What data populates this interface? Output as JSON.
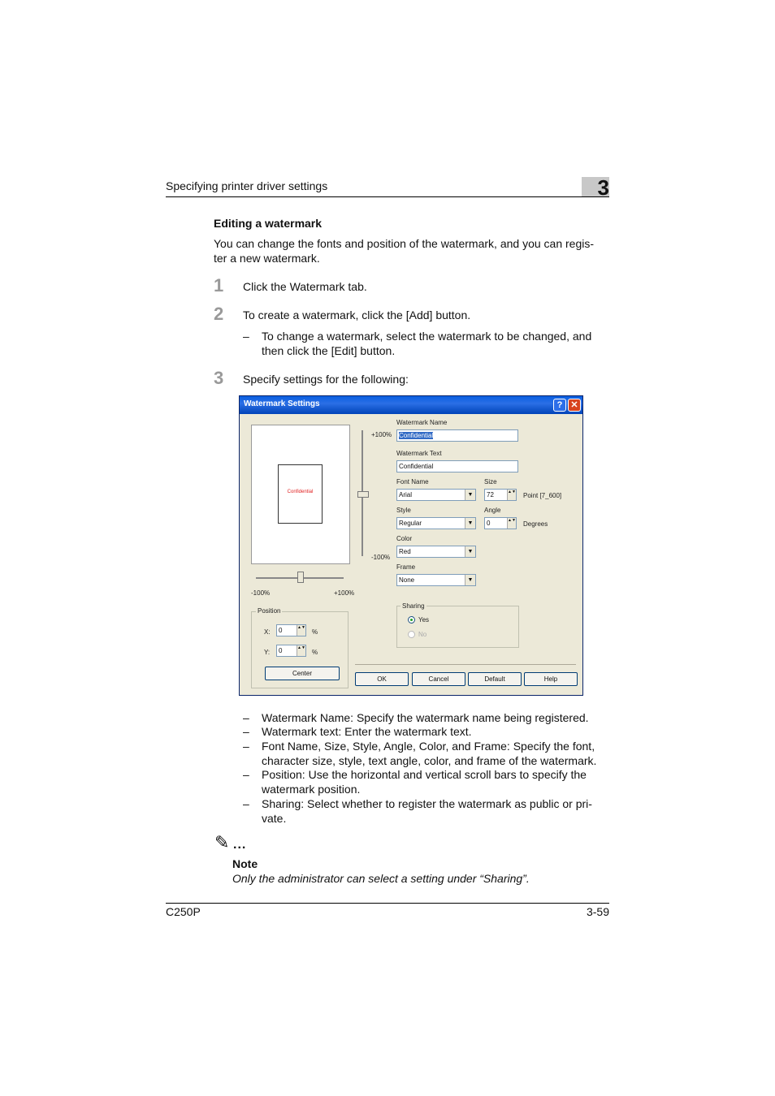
{
  "header": {
    "title": "Specifying printer driver settings",
    "chapter": "3"
  },
  "section": {
    "title": "Editing a watermark",
    "intro_line1": "You can change the fonts and position of the watermark, and you can regis-",
    "intro_line2": "ter a new watermark."
  },
  "steps": [
    {
      "num": "1",
      "text": "Click the Watermark tab."
    },
    {
      "num": "2",
      "text": "To create a watermark, click the [Add] button.",
      "sub_dash": "–",
      "sub_line1": "To change a watermark, select the watermark to be changed, and",
      "sub_line2": "then click the [Edit] button."
    },
    {
      "num": "3",
      "text": "Specify settings for the following:"
    }
  ],
  "dialog": {
    "title": "Watermark Settings",
    "help_glyph": "?",
    "close_glyph": "✕",
    "preview_text": "Confidential",
    "vscroll_top": "+100%",
    "vscroll_bottom": "-100%",
    "hscroll_left": "-100%",
    "hscroll_right": "+100%",
    "name_label": "Watermark Name",
    "name_value": "Confidential",
    "text_label": "Watermark Text",
    "text_value": "Confidential",
    "font_label": "Font Name",
    "font_value": "Arial",
    "size_label": "Size",
    "size_value": "72",
    "size_unit": "Point [7_600]",
    "style_label": "Style",
    "style_value": "Regular",
    "angle_label": "Angle",
    "angle_value": "0",
    "angle_unit": "Degrees",
    "color_label": "Color",
    "color_value": "Red",
    "frame_label": "Frame",
    "frame_value": "None",
    "sharing_label": "Sharing",
    "sharing_yes": "Yes",
    "sharing_no": "No",
    "position_label": "Position",
    "x_label": "X:",
    "x_value": "0",
    "y_label": "Y:",
    "y_value": "0",
    "percent": "%",
    "center_btn": "Center",
    "ok_btn": "OK",
    "cancel_btn": "Cancel",
    "default_btn": "Default",
    "help_btn": "Help",
    "dropdown_glyph": "▼",
    "spin_glyph": "▲▼",
    "preview_color": "#e02020"
  },
  "bullets": {
    "dash": "–",
    "items": [
      {
        "line1": "Watermark Name: Specify the watermark name being registered.",
        "line2": ""
      },
      {
        "line1": "Watermark text: Enter the watermark text.",
        "line2": ""
      },
      {
        "line1": "Font Name, Size, Style, Angle, Color, and Frame: Specify the font,",
        "line2": "character size, style, text angle, color, and frame of the watermark."
      },
      {
        "line1": "Position: Use the horizontal and vertical scroll bars to specify the",
        "line2": "watermark position."
      },
      {
        "line1": "Sharing: Select whether to register the watermark as public or pri-",
        "line2": "vate."
      }
    ]
  },
  "note": {
    "icon": "✎",
    "dots": "...",
    "title": "Note",
    "text": "Only the administrator can select a setting under “Sharing”."
  },
  "footer": {
    "model": "C250P",
    "page": "3-59"
  }
}
